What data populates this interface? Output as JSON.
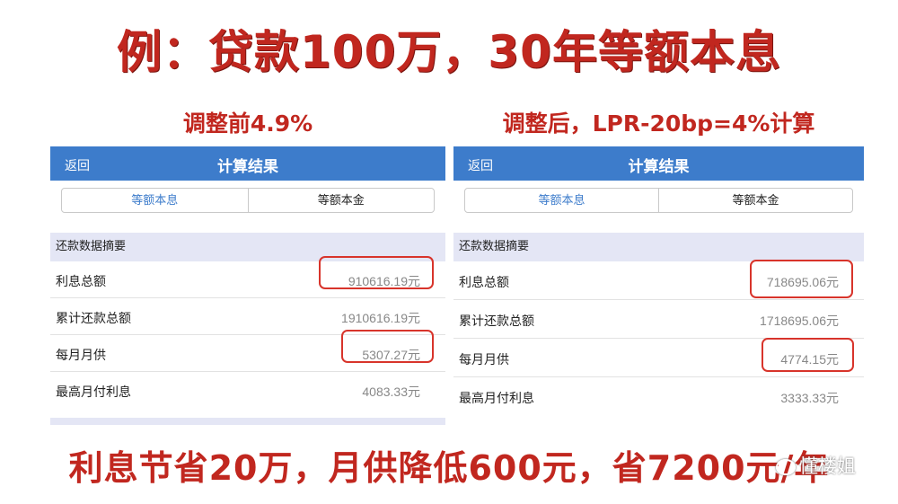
{
  "headline": "例：贷款100万，30年等额本息",
  "footer": "利息节省20万，月供降低600元，省7200元/年",
  "watermark": "懂楼姐",
  "accent_color": "#c1271f",
  "bar_color": "#3d7ccb",
  "highlight_color": "#d8342b",
  "panels": [
    {
      "title": "调整前4.9%",
      "back_label": "返回",
      "header_title": "计算结果",
      "tabs": [
        {
          "label": "等额本息",
          "active": true
        },
        {
          "label": "等额本金",
          "active": false
        }
      ],
      "summary_label": "还款数据摘要",
      "rows": [
        {
          "label": "利息总额",
          "value": "910616.19元",
          "highlighted": true
        },
        {
          "label": "累计还款总额",
          "value": "1910616.19元",
          "highlighted": false
        },
        {
          "label": "每月月供",
          "value": "5307.27元",
          "highlighted": true
        },
        {
          "label": "最高月付利息",
          "value": "4083.33元",
          "highlighted": false
        }
      ]
    },
    {
      "title": "调整后，LPR-20bp=4%计算",
      "back_label": "返回",
      "header_title": "计算结果",
      "tabs": [
        {
          "label": "等额本息",
          "active": true
        },
        {
          "label": "等额本金",
          "active": false
        }
      ],
      "summary_label": "还款数据摘要",
      "rows": [
        {
          "label": "利息总额",
          "value": "718695.06元",
          "highlighted": true
        },
        {
          "label": "累计还款总额",
          "value": "1718695.06元",
          "highlighted": false
        },
        {
          "label": "每月月供",
          "value": "4774.15元",
          "highlighted": true
        },
        {
          "label": "最高月付利息",
          "value": "3333.33元",
          "highlighted": false
        }
      ]
    }
  ]
}
